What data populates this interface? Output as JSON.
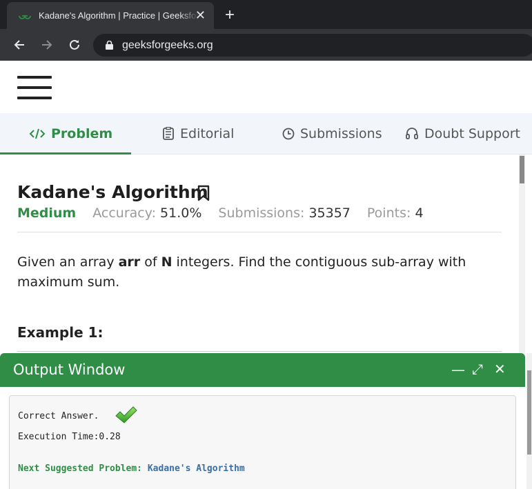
{
  "browser": {
    "tab_title": "Kadane's Algorithm | Practice | GeeksforGeeks",
    "tab_close": "✕",
    "new_tab": "+",
    "url": "geeksforgeeks.org",
    "back_icon": "arrow-left-icon",
    "forward_icon": "arrow-right-icon",
    "reload_icon": "reload-icon"
  },
  "tabs": [
    {
      "label": "Problem",
      "icon": "code-icon",
      "active": true
    },
    {
      "label": "Editorial",
      "icon": "document-icon",
      "active": false
    },
    {
      "label": "Submissions",
      "icon": "clock-icon",
      "active": false
    },
    {
      "label": "Doubt Support",
      "icon": "headset-icon",
      "active": false
    }
  ],
  "problem": {
    "title": "Kadane's Algorithm",
    "difficulty": "Medium",
    "accuracy_label": "Accuracy:",
    "accuracy_value": "51.0%",
    "submissions_label": "Submissions:",
    "submissions_value": "35357",
    "points_label": "Points:",
    "points_value": "4",
    "desc_1": "Given an array ",
    "desc_arr": "arr",
    "desc_2": " of ",
    "desc_n": "N",
    "desc_3": " integers. Find the contiguous sub-array with maximum sum.",
    "example_heading": "Example 1:"
  },
  "output": {
    "title": "Output Window",
    "minimize": "—",
    "expand": "⤢",
    "close": "✕",
    "result": "Correct Answer.",
    "exec_time": "Execution Time:0.28",
    "next_label": "Next Suggested Problem:",
    "next_problem": "Kadane's Algorithm"
  },
  "colors": {
    "brand_green": "#2f8d46",
    "link_blue": "#3a6ea5"
  }
}
